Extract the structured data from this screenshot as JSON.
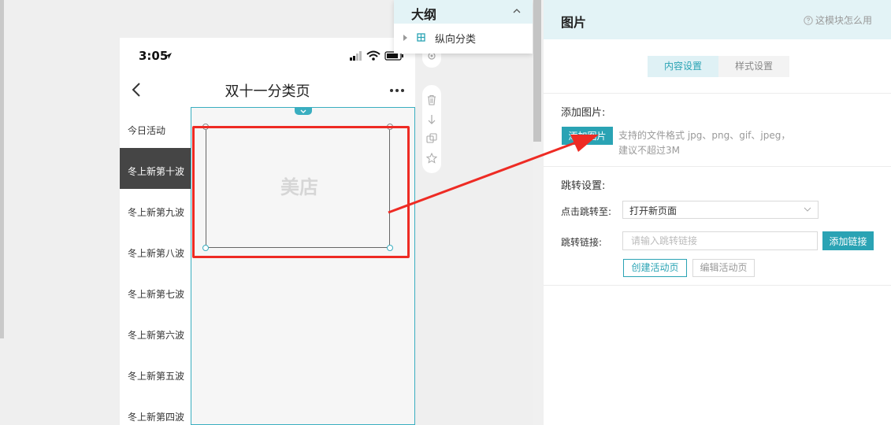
{
  "phone": {
    "time": "3:05",
    "nav_title": "双十一分类页",
    "categories": [
      {
        "label": "今日活动",
        "active": false
      },
      {
        "label": "冬上新第十波",
        "active": true
      },
      {
        "label": "冬上新第九波",
        "active": false
      },
      {
        "label": "冬上新第八波",
        "active": false
      },
      {
        "label": "冬上新第七波",
        "active": false
      },
      {
        "label": "冬上新第六波",
        "active": false
      },
      {
        "label": "冬上新第五波",
        "active": false
      },
      {
        "label": "冬上新第四波",
        "active": false
      }
    ],
    "placeholder_logo": "美店"
  },
  "outline": {
    "title": "大纲",
    "item": "纵向分类"
  },
  "panel": {
    "title": "图片",
    "help": "这模块怎么用",
    "tabs": [
      "内容设置",
      "样式设置"
    ],
    "add_image_label": "添加图片:",
    "add_image_button": "添加图片",
    "hint_line1": "支持的文件格式 jpg、png、gif、jpeg，",
    "hint_line2": "建议不超过3M",
    "jump_label": "跳转设置:",
    "jump_to_label": "点击跳转至:",
    "jump_to_value": "打开新页面",
    "link_label": "跳转链接:",
    "link_placeholder": "请输入跳转链接",
    "add_link_button": "添加链接",
    "create_page_button": "创建活动页",
    "edit_page_button": "编辑活动页"
  },
  "colors": {
    "accent": "#2aa3b4",
    "annotation": "#ee2b24",
    "header_bg": "#e3f3f6"
  }
}
